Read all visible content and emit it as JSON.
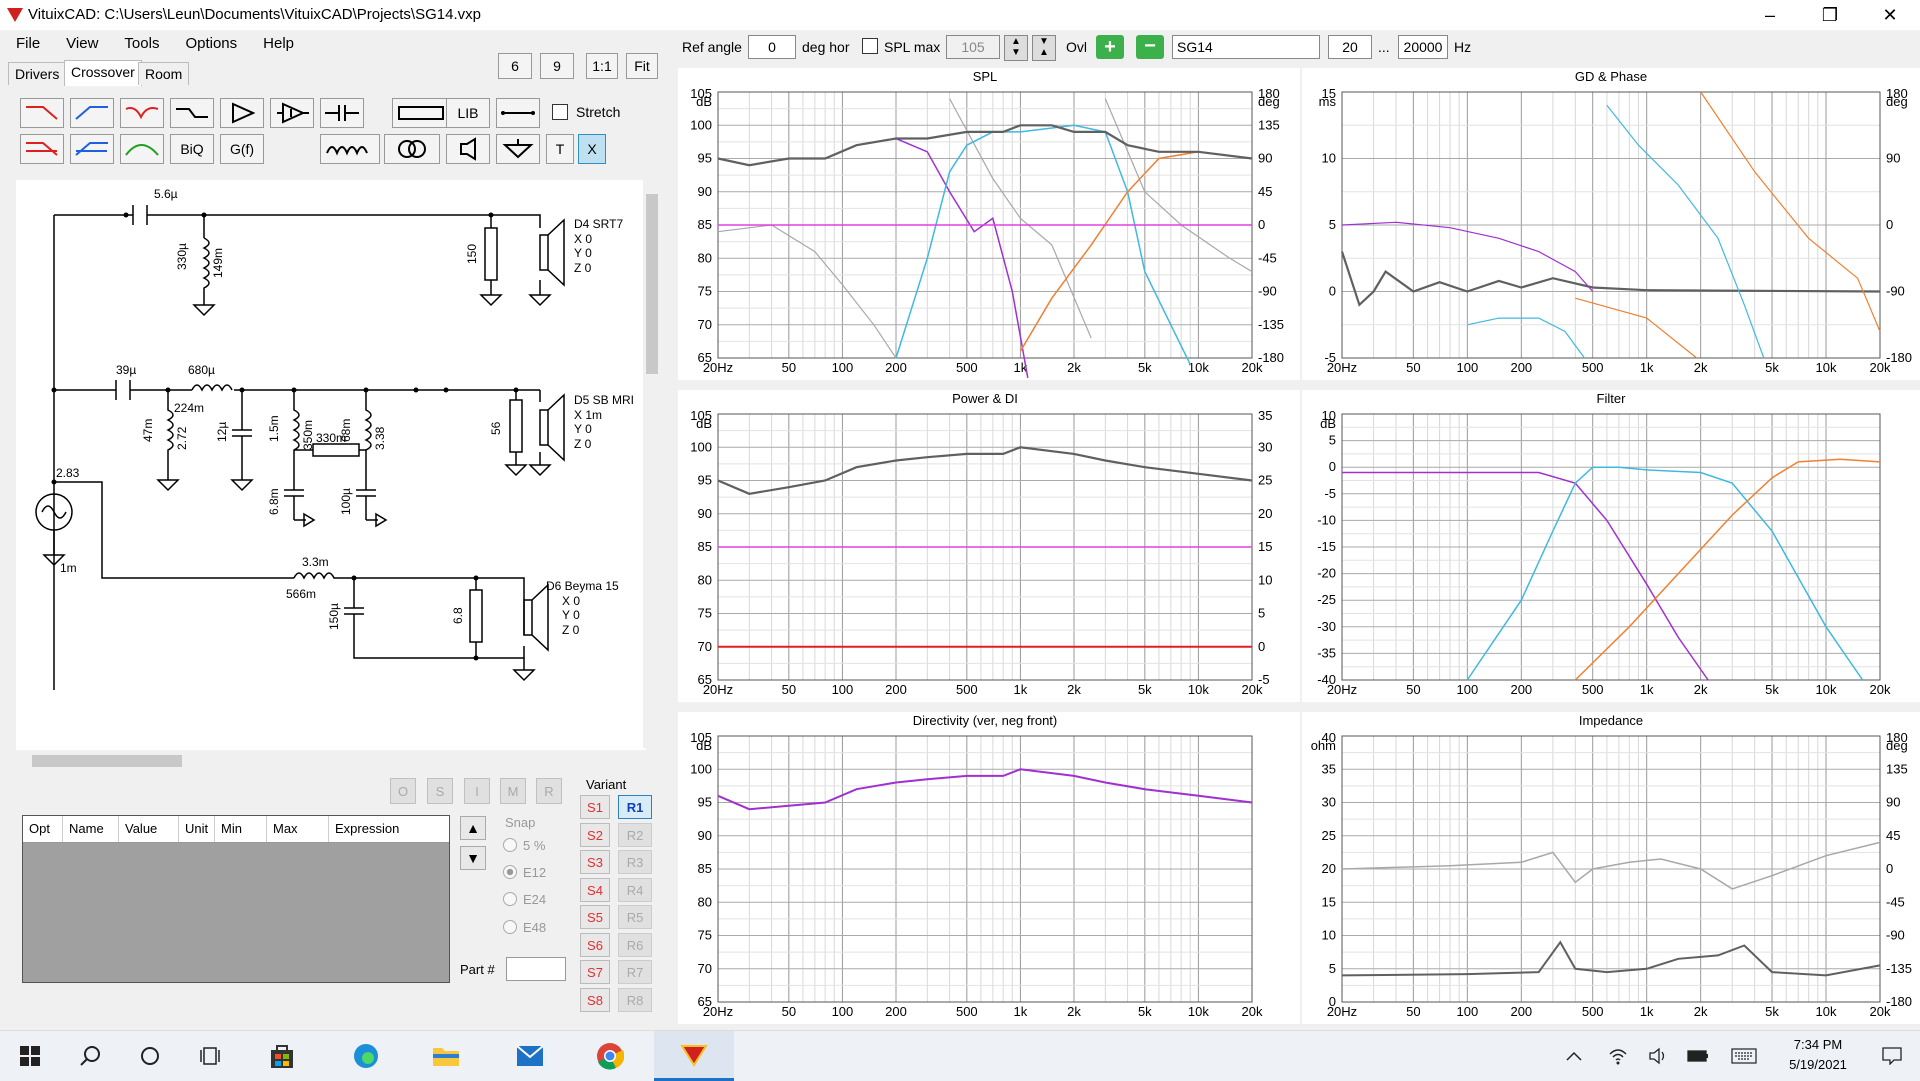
{
  "window": {
    "title": "VituixCAD: C:\\Users\\Leun\\Documents\\VituixCAD\\Projects\\SG14.vxp"
  },
  "menu": [
    "File",
    "View",
    "Tools",
    "Options",
    "Help"
  ],
  "tabs": [
    "Drivers",
    "Crossover",
    "Room"
  ],
  "order_buttons": [
    "6",
    "9",
    "1:1",
    "Fit"
  ],
  "toolbar": {
    "biq": "BiQ",
    "gf": "G(f)",
    "lib": "LIB",
    "t": "T",
    "x": "X",
    "stretch_label": "Stretch"
  },
  "top_controls": {
    "ref_angle_label": "Ref angle",
    "ref_angle_value": "0",
    "deg_hor": "deg hor",
    "spl_max_label": "SPL max",
    "spl_max_value": "105",
    "ovl_label": "Ovl",
    "name_value": "SG14",
    "f_from": "20",
    "ellipsis": "...",
    "f_to": "20000",
    "hz": "Hz"
  },
  "schematic": {
    "labels": {
      "c1": "5.6µ",
      "l1a": "330µ",
      "l1b": "149m",
      "r_tw": "150",
      "drv1": "D4 SRT7",
      "drv1_x": "X 0",
      "drv1_y": "Y 0",
      "drv1_z": "Z 0",
      "c2": "39µ",
      "l2": "680µ",
      "l2r": "224m",
      "l3a": "47m",
      "l3b": "2.72",
      "c3": "12µ",
      "l4a": "1.5m",
      "l4b": "350m",
      "r4": "330m",
      "l5a": "68m",
      "l5b": "3.38",
      "c4": "6.8m",
      "c5": "100µ",
      "r_mid": "56",
      "drv2": "D5 SB MRI",
      "drv2_x": "X 1m",
      "drv2_y": "Y 0",
      "drv2_z": "Z 0",
      "src_v": "2.83",
      "src_r": "1m",
      "l6a": "3.3m",
      "l6b": "566m",
      "c6": "150µ",
      "r_wf": "6.8",
      "drv3": "D6 Beyma 15",
      "drv3_x": "X 0",
      "drv3_y": "Y 0",
      "drv3_z": "Z 0"
    }
  },
  "opt_buttons": [
    "O",
    "S",
    "I",
    "M",
    "R"
  ],
  "opt_table": {
    "columns": [
      "Opt",
      "Name",
      "Value",
      "Unit",
      "Min",
      "Max",
      "Expression"
    ]
  },
  "snap": {
    "label": "Snap",
    "options": [
      "5 %",
      "E12",
      "E24",
      "E48"
    ],
    "selected": "E12"
  },
  "part_label": "Part #",
  "variant": {
    "label": "Variant",
    "s": [
      "S1",
      "S2",
      "S3",
      "S4",
      "S5",
      "S6",
      "S7",
      "S8"
    ],
    "r": [
      "R1",
      "R2",
      "R3",
      "R4",
      "R5",
      "R6",
      "R7",
      "R8"
    ],
    "active_r": "R1"
  },
  "charts": {
    "spl": {
      "title": "SPL",
      "yunit": "dB",
      "y2unit": "deg",
      "y_ticks": [
        "105",
        "100",
        "95",
        "90",
        "85",
        "80",
        "75",
        "70",
        "65"
      ],
      "y2_ticks": [
        "180",
        "135",
        "90",
        "45",
        "0",
        "-45",
        "-90",
        "-135",
        "-180"
      ],
      "x_ticks": [
        "20Hz",
        "50",
        "100",
        "200",
        "500",
        "1k",
        "2k",
        "5k",
        "10k",
        "20k"
      ]
    },
    "gd": {
      "title": "GD & Phase",
      "yunit": "ms",
      "y2unit": "deg",
      "y_ticks": [
        "15",
        "10",
        "5",
        "0",
        "-5"
      ],
      "y2_ticks": [
        "180",
        "90",
        "0",
        "-90",
        "-180"
      ],
      "x_ticks": [
        "20Hz",
        "50",
        "100",
        "200",
        "500",
        "1k",
        "2k",
        "5k",
        "10k",
        "20k"
      ]
    },
    "power": {
      "title": "Power & DI",
      "yunit": "dB",
      "y_ticks": [
        "105",
        "100",
        "95",
        "90",
        "85",
        "80",
        "75",
        "70",
        "65"
      ],
      "y2_ticks": [
        "35",
        "30",
        "25",
        "20",
        "15",
        "10",
        "5",
        "0",
        "-5"
      ],
      "x_ticks": [
        "20Hz",
        "50",
        "100",
        "200",
        "500",
        "1k",
        "2k",
        "5k",
        "10k",
        "20k"
      ]
    },
    "filter": {
      "title": "Filter",
      "yunit": "dB",
      "y_ticks": [
        "10",
        "5",
        "0",
        "-5",
        "-10",
        "-15",
        "-20",
        "-25",
        "-30",
        "-35",
        "-40"
      ],
      "x_ticks": [
        "20Hz",
        "50",
        "100",
        "200",
        "500",
        "1k",
        "2k",
        "5k",
        "10k",
        "20k"
      ]
    },
    "directivity": {
      "title": "Directivity (ver, neg front)",
      "yunit": "dB",
      "y_ticks": [
        "105",
        "100",
        "95",
        "90",
        "85",
        "80",
        "75",
        "70",
        "65"
      ],
      "x_ticks": [
        "20Hz",
        "50",
        "100",
        "200",
        "500",
        "1k",
        "2k",
        "5k",
        "10k",
        "20k"
      ]
    },
    "impedance": {
      "title": "Impedance",
      "yunit": "ohm",
      "y2unit": "deg",
      "y_ticks": [
        "40",
        "35",
        "30",
        "25",
        "20",
        "15",
        "10",
        "5",
        "0"
      ],
      "y2_ticks": [
        "180",
        "135",
        "90",
        "45",
        "0",
        "-45",
        "-90",
        "-135",
        "-180"
      ],
      "x_ticks": [
        "20Hz",
        "50",
        "100",
        "200",
        "500",
        "1k",
        "2k",
        "5k",
        "10k",
        "20k"
      ]
    }
  },
  "colors": {
    "woofer": "#a030d0",
    "mid": "#40b8e0",
    "tweeter": "#f08030",
    "sum": "#606060",
    "ref": "#e040e0",
    "di": "#e02020",
    "phase": "#a8a8a8"
  },
  "taskbar": {
    "time": "7:34 PM",
    "date": "5/19/2021"
  }
}
